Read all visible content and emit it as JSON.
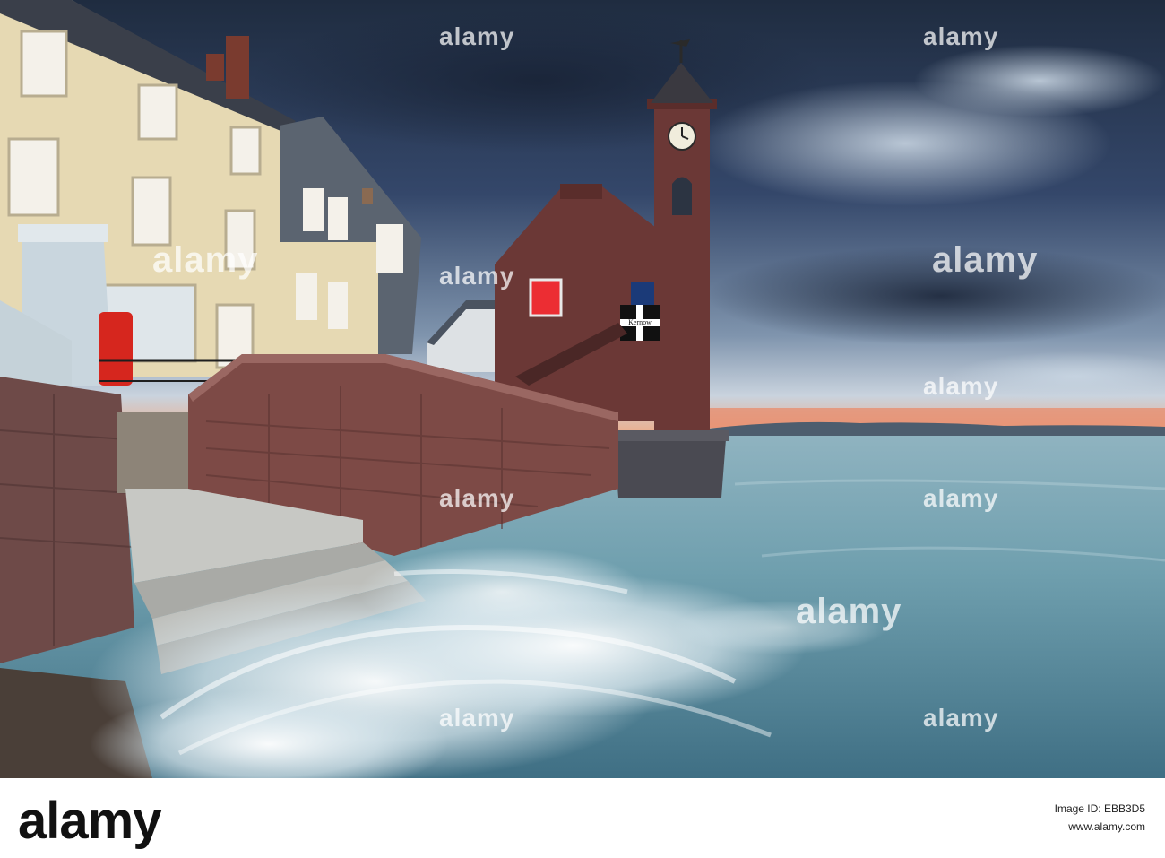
{
  "watermarks": {
    "large": "alamy",
    "small": "alamy"
  },
  "scene": {
    "flag_text": "Kernow"
  },
  "footer": {
    "logo": "alamy",
    "image_id_label": "Image ID: EBB3D5",
    "site": "www.alamy.com"
  },
  "colors": {
    "sky_dark": "#26364d",
    "sky_light": "#c7d3e0",
    "sunset": "#e88b6b",
    "sea": "#6f9fae",
    "brick": "#6b3836",
    "render": "#e7dbb6"
  }
}
